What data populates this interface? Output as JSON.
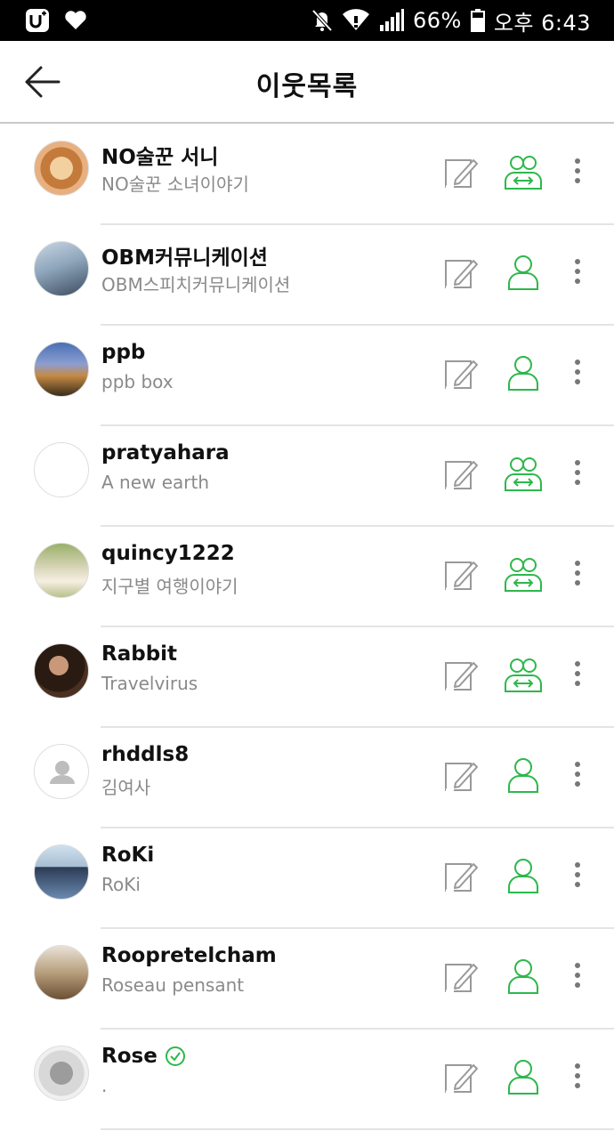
{
  "statusbar": {
    "battery": "66%",
    "time": "오후 6:43"
  },
  "header": {
    "title": "이웃목록"
  },
  "colors": {
    "accent": "#2db84b",
    "icon_gray": "#999999"
  },
  "neighbors": [
    {
      "name": "NO술꾼 서니",
      "desc": "NO술꾼 소녀이야기",
      "relation": "mutual",
      "verified": false
    },
    {
      "name": "OBM커뮤니케이션",
      "desc": "OBM스피치커뮤니케이션",
      "relation": "single",
      "verified": false
    },
    {
      "name": "ppb",
      "desc": "ppb box",
      "relation": "single",
      "verified": false
    },
    {
      "name": "pratyahara",
      "desc": "A new earth",
      "relation": "mutual",
      "verified": false
    },
    {
      "name": "quincy1222",
      "desc": "지구별 여행이야기",
      "relation": "mutual",
      "verified": false
    },
    {
      "name": "Rabbit",
      "desc": "Travelvirus",
      "relation": "mutual",
      "verified": false
    },
    {
      "name": "rhddls8",
      "desc": "김여사",
      "relation": "single",
      "verified": false
    },
    {
      "name": "RoKi",
      "desc": "RoKi",
      "relation": "single",
      "verified": false
    },
    {
      "name": "Roopretelcham",
      "desc": "Roseau pensant",
      "relation": "single",
      "verified": false
    },
    {
      "name": "Rose",
      "desc": ".",
      "relation": "single",
      "verified": true
    }
  ]
}
